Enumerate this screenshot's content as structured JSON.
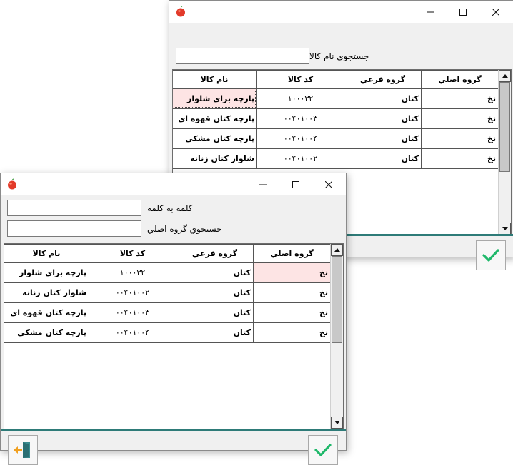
{
  "back_window": {
    "search_label": "جستجوي نام كالا",
    "search_value": "",
    "columns": [
      "گروه اصلي",
      "گروه فرعي",
      "کد کالا",
      "نام کالا"
    ],
    "rows": [
      {
        "main": "نخ",
        "sub": "کتان",
        "code": "۱۰۰۰۳۲",
        "name": "پارچه برای شلوار"
      },
      {
        "main": "نخ",
        "sub": "کتان",
        "code": "۰۰۴۰۱۰۰۳",
        "name": "پارچه کتان قهوه ای"
      },
      {
        "main": "نخ",
        "sub": "کتان",
        "code": "۰۰۴۰۱۰۰۴",
        "name": "پارچه کتان مشکی"
      },
      {
        "main": "نخ",
        "sub": "کتان",
        "code": "۰۰۴۰۱۰۰۲",
        "name": "شلوار کتان زنانه"
      }
    ]
  },
  "front_window": {
    "word_label": "کلمه به کلمه",
    "word_value": "",
    "group_label": "جستجوي گروه اصلي",
    "group_value": "",
    "columns": [
      "گروه اصلي",
      "گروه فرعي",
      "کد کالا",
      "نام کالا"
    ],
    "rows": [
      {
        "main": "نخ",
        "sub": "کتان",
        "code": "۱۰۰۰۳۲",
        "name": "پارچه برای شلوار"
      },
      {
        "main": "نخ",
        "sub": "کتان",
        "code": "۰۰۴۰۱۰۰۲",
        "name": "شلوار کتان زنانه"
      },
      {
        "main": "نخ",
        "sub": "کتان",
        "code": "۰۰۴۰۱۰۰۳",
        "name": "پارچه کتان قهوه ای"
      },
      {
        "main": "نخ",
        "sub": "کتان",
        "code": "۰۰۴۰۱۰۰۴",
        "name": "پارچه کتان مشکی"
      }
    ]
  },
  "colors": {
    "teal": "#2e7b78",
    "check_green": "#1fb86a",
    "exit_orange": "#f0a020",
    "exit_teal": "#3a8c90"
  }
}
